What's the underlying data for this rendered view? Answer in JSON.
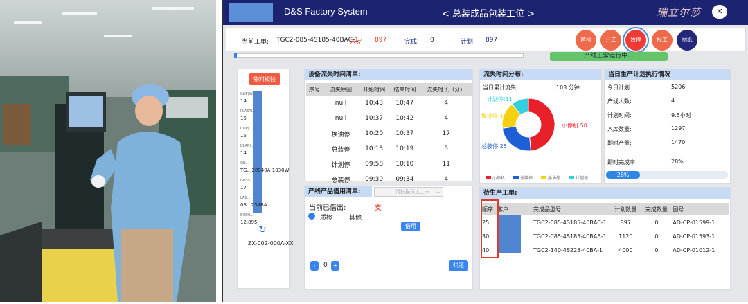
{
  "app": {
    "system_title": "D&S Factory System",
    "station_title": "< 总装成品包装工位 >",
    "brand_text": "瑞立尔莎",
    "brand_close": "✕"
  },
  "order": {
    "current_label": "当前工单:",
    "current_value": "TGC2-085-4S185-40BAC-1",
    "unfinished_label": "未完",
    "unfinished_value": "897",
    "done_label": "完成",
    "done_value": "0",
    "plan_label": "计划",
    "plan_value": "897"
  },
  "actions": [
    "首检",
    "开工",
    "暂停",
    "报工",
    "图纸"
  ],
  "status_text": "产线正常运行中...",
  "progress_percent": 1,
  "left_panel": {
    "top_button": "物料校验",
    "entries": [
      {
        "label": "CLIP(W...)",
        "value": "14"
      },
      {
        "label": "PLASTI...",
        "value": "15"
      },
      {
        "label": "CLIP(...)",
        "value": "15"
      },
      {
        "label": "BEARI...",
        "value": "14"
      },
      {
        "label": "ON...",
        "value": "TG...20940A-1030W"
      },
      {
        "label": "GUSS...",
        "value": "17"
      },
      {
        "label": "LAB...",
        "value": "03...254BA"
      },
      {
        "label": "BUSH...",
        "value": "12.895"
      }
    ],
    "refresh_icon": "refresh-icon",
    "device_id": "ZX-002-000A-XX"
  },
  "downtime": {
    "title": "设备流失时间清单:",
    "headers": [
      "序号",
      "流失原因",
      "开始时间",
      "结束时间",
      "流失时长（分）"
    ],
    "rows": [
      [
        "",
        "null",
        "10:43",
        "10:47",
        "4"
      ],
      [
        "",
        "null",
        "10:37",
        "10:42",
        "4"
      ],
      [
        "",
        "换油停",
        "10:20",
        "10:37",
        "17"
      ],
      [
        "",
        "总装停",
        "10:13",
        "10:19",
        "5"
      ],
      [
        "",
        "计划停",
        "09:58",
        "10:10",
        "11"
      ],
      [
        "",
        "总装停",
        "09:30",
        "09:34",
        "4"
      ]
    ]
  },
  "borrow": {
    "title": "产线产品借用清单:",
    "scan_placeholder": "请扫描员工工卡",
    "borrowed_label": "当前已借出:",
    "borrowed_unit": "支",
    "option_check": "质检",
    "option_other": "其他",
    "borrow_button": "借用",
    "minus": "-",
    "count": "0",
    "plus": "+",
    "return_button": "归还"
  },
  "loss_dist": {
    "title": "流失时间分布:",
    "cumulative_label": "当日累计流失:",
    "cumulative_value": "103 分钟",
    "legend": [
      "小停机",
      "总装停",
      "换油停",
      "计划停"
    ]
  },
  "chart_data": {
    "type": "pie",
    "categories": [
      "小停机",
      "总装停",
      "换油停",
      "计划停"
    ],
    "values": [
      50,
      25,
      17,
      11
    ],
    "colors": [
      "#e8202a",
      "#1f5fd6",
      "#f5d10f",
      "#32d0e0"
    ],
    "labels": [
      "小停机:50",
      "总装停:25",
      "换油停:17",
      "计划停:11"
    ]
  },
  "plan_exec": {
    "title": "当日生产计划执行情况",
    "rows": [
      {
        "label": "今日计划:",
        "value": "5206"
      },
      {
        "label": "产线人数:",
        "value": "4"
      },
      {
        "label": "计划时间:",
        "value": "9.5小时"
      },
      {
        "label": "入库数量:",
        "value": "1297"
      },
      {
        "label": "即时产量:",
        "value": "1470"
      },
      {
        "label": "即时完成率:",
        "value": "28%"
      }
    ],
    "rate_text": "28%",
    "rate_value": 28
  },
  "pending": {
    "title": "待生产工单:",
    "headers": [
      "顺序",
      "客户",
      "完成品型号",
      "计划数量",
      "完成数量",
      "图号"
    ],
    "rows": [
      [
        "25",
        "",
        "TGC2-085-4S185-40BAC-1",
        "897",
        "0",
        "AD-CP-01599-1"
      ],
      [
        "30",
        "",
        "TGC2-085-4S185-40BAB-1",
        "1120",
        "0",
        "AD-CP-01593-1"
      ],
      [
        "40",
        "",
        "TGC2-140-4S225-40BA-1",
        "4000",
        "0",
        "AD-CP-01012-1"
      ]
    ]
  }
}
